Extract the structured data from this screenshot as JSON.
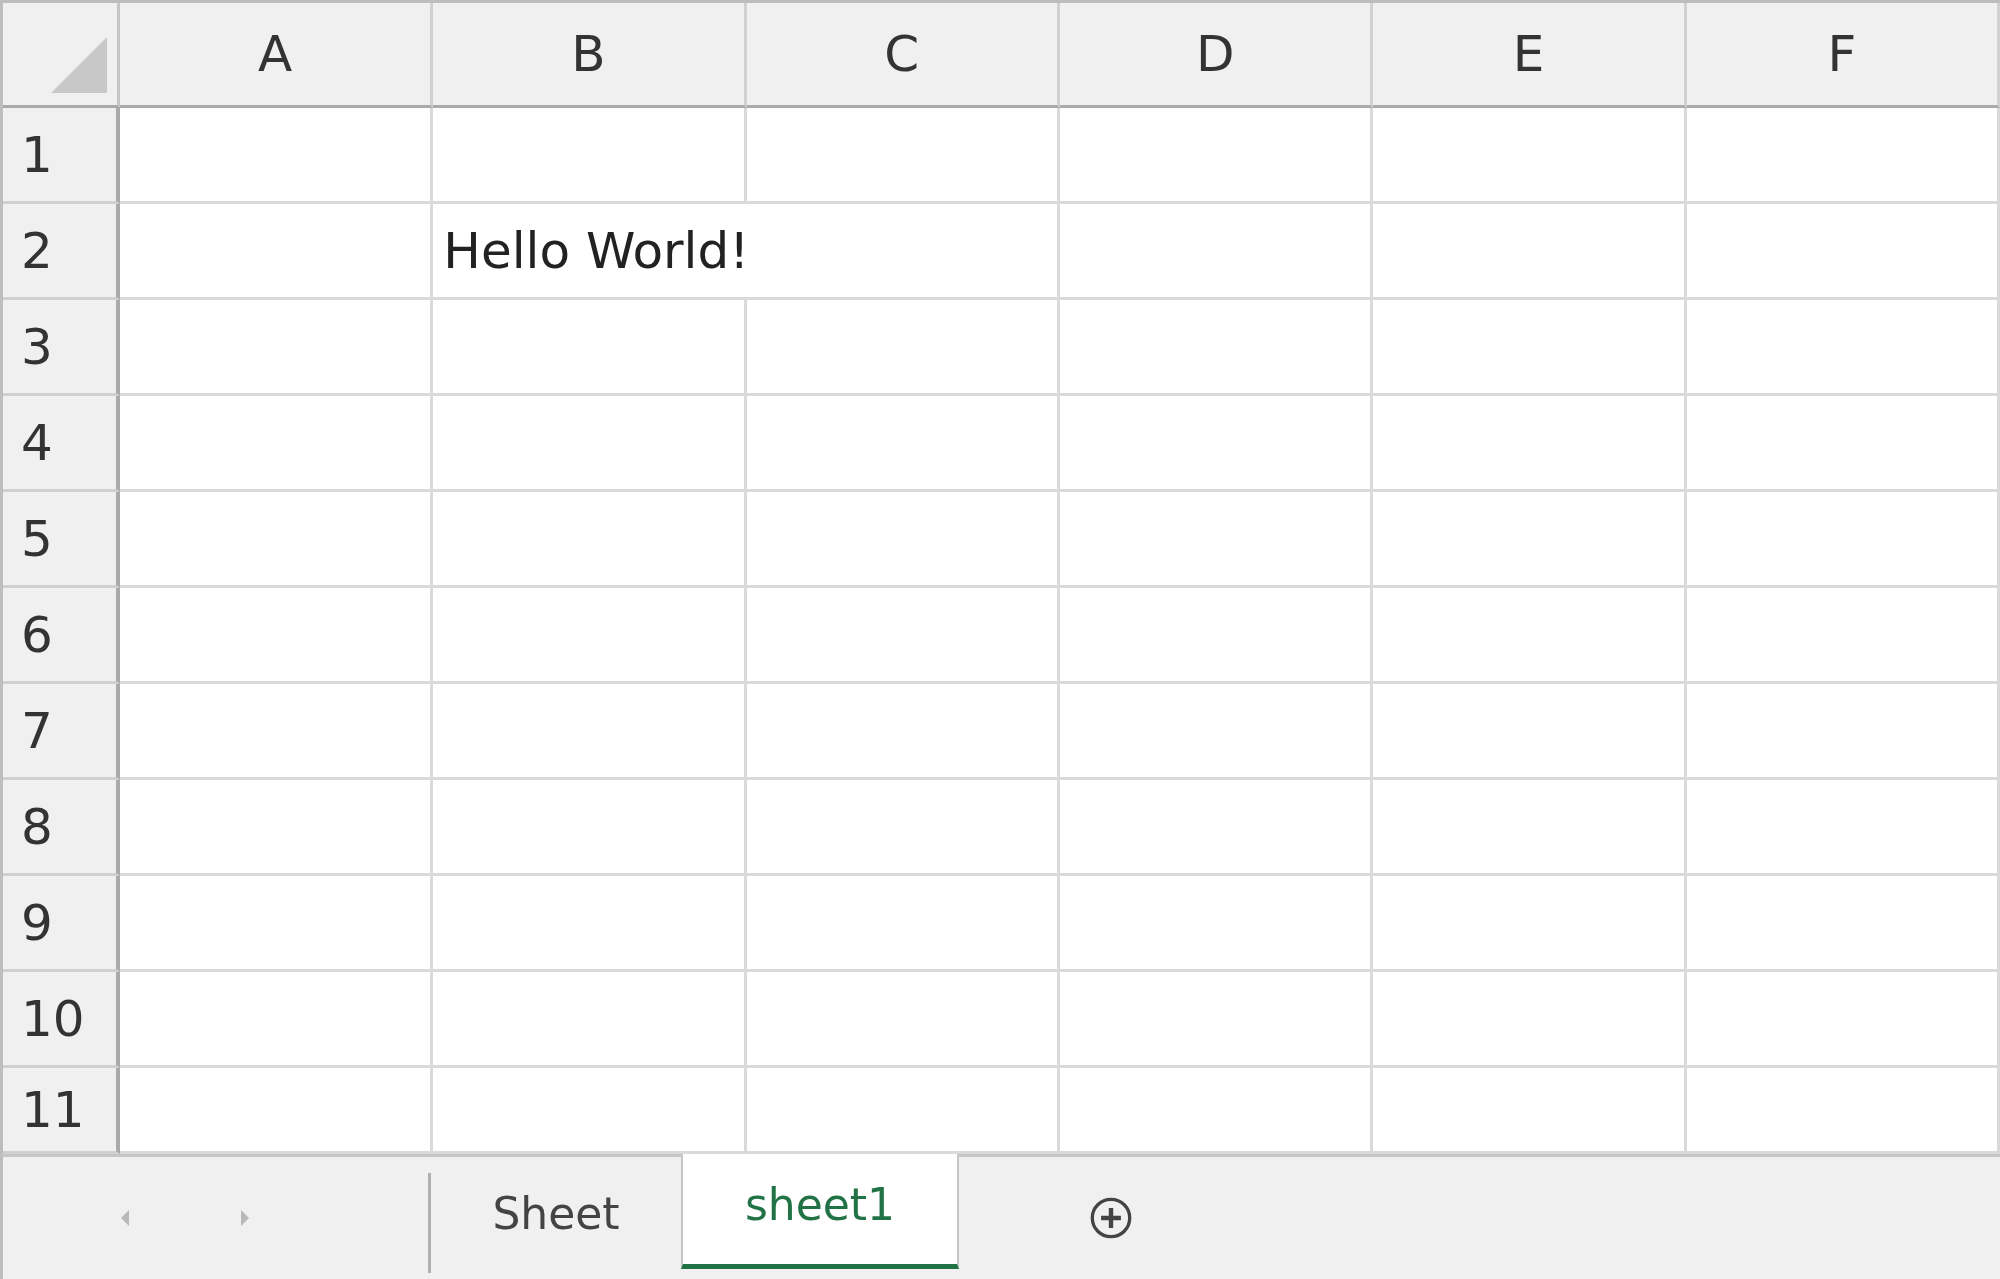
{
  "columns": [
    {
      "label": "A"
    },
    {
      "label": "B"
    },
    {
      "label": "C"
    },
    {
      "label": "D"
    },
    {
      "label": "E"
    },
    {
      "label": "F"
    }
  ],
  "rows": [
    {
      "label": "1"
    },
    {
      "label": "2",
      "cells": [
        null,
        "Hello World!"
      ]
    },
    {
      "label": "3"
    },
    {
      "label": "4"
    },
    {
      "label": "5"
    },
    {
      "label": "6"
    },
    {
      "label": "7"
    },
    {
      "label": "8"
    },
    {
      "label": "9"
    },
    {
      "label": "10"
    },
    {
      "label": "11"
    }
  ],
  "sheet_nav": [
    {
      "kind": "previous",
      "disabled": true
    },
    {
      "kind": "next",
      "disabled": true
    }
  ],
  "sheet_tabs": [
    {
      "label": "Sheet",
      "selected": false
    },
    {
      "label": "sheet1",
      "selected": true
    }
  ]
}
